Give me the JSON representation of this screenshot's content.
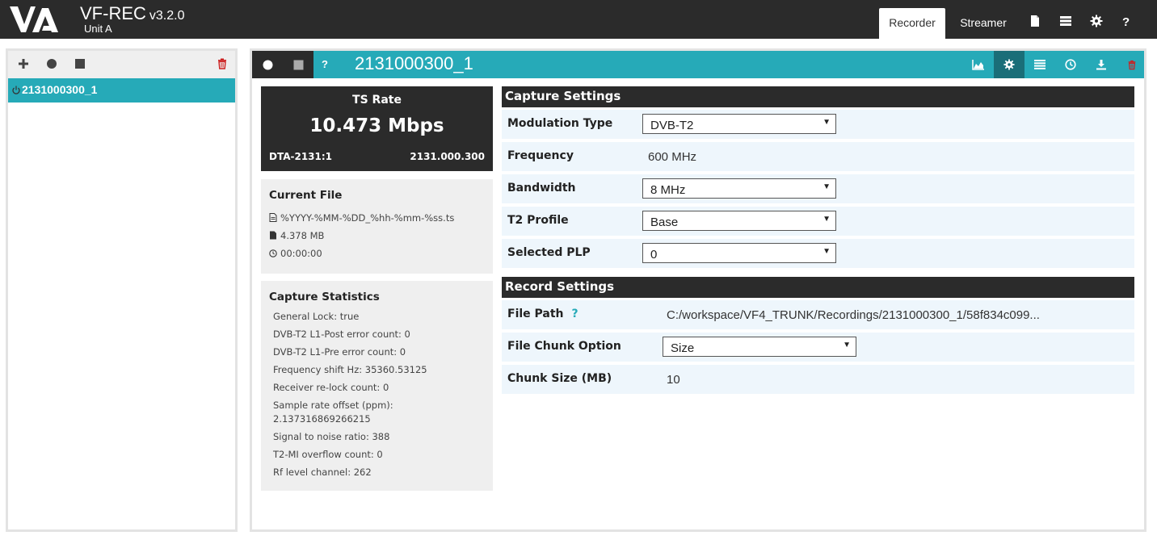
{
  "header": {
    "app_name": "VF-REC",
    "version": "v3.2.0",
    "unit": "Unit A",
    "tabs": [
      {
        "label": "Recorder",
        "active": true
      },
      {
        "label": "Streamer",
        "active": false
      }
    ],
    "icons": [
      "file-icon",
      "list-icon",
      "gear-icon",
      "help-icon"
    ]
  },
  "sidebar": {
    "toolbar_icons": [
      "add-icon",
      "record-icon",
      "stop-icon",
      "trash-icon"
    ],
    "items": [
      {
        "label": "2131000300_1",
        "icon": "power-icon",
        "selected": true
      }
    ]
  },
  "main": {
    "title": "2131000300_1",
    "left_buttons": [
      "record-icon",
      "stop-icon"
    ],
    "help_label": "?",
    "right_icons": [
      "chart-icon",
      "gear-icon",
      "list-icon",
      "clock-icon",
      "download-icon",
      "trash-icon"
    ],
    "ts_rate": {
      "label": "TS Rate",
      "value": "10.473 Mbps",
      "device": "DTA-2131:1",
      "id": "2131.000.300"
    },
    "current_file": {
      "title": "Current File",
      "pattern": "%YYYY-%MM-%DD_%hh-%mm-%ss.ts",
      "size": "4.378 MB",
      "duration": "00:00:00"
    },
    "capture_statistics": {
      "title": "Capture Statistics",
      "lines": [
        "General Lock: true",
        "DVB-T2 L1-Post error count: 0",
        "DVB-T2 L1-Pre error count: 0",
        "Frequency shift Hz: 35360.53125",
        "Receiver re-lock count: 0",
        "Sample rate offset (ppm):",
        "2.137316869266215",
        "Signal to noise ratio: 388",
        "T2-MI overflow count: 0",
        "Rf level channel: 262"
      ]
    },
    "capture_settings": {
      "title": "Capture Settings",
      "modulation_label": "Modulation Type",
      "modulation_value": "DVB-T2",
      "frequency_label": "Frequency",
      "frequency_value": "600 MHz",
      "bandwidth_label": "Bandwidth",
      "bandwidth_value": "8 MHz",
      "t2_profile_label": "T2 Profile",
      "t2_profile_value": "Base",
      "plp_label": "Selected PLP",
      "plp_value": "0"
    },
    "record_settings": {
      "title": "Record Settings",
      "file_path_label": "File Path",
      "file_path_help": "?",
      "file_path_value": "C:/workspace/VF4_TRUNK/Recordings/2131000300_1/58f834c099...",
      "chunk_option_label": "File Chunk Option",
      "chunk_option_value": "Size",
      "chunk_size_label": "Chunk Size (MB)",
      "chunk_size_value": "10"
    }
  },
  "colors": {
    "accent": "#26aab8",
    "dark": "#2b2b2b",
    "panel_bg": "#efefef",
    "row_bg": "#eef6fc",
    "danger": "#cc1f1f"
  }
}
